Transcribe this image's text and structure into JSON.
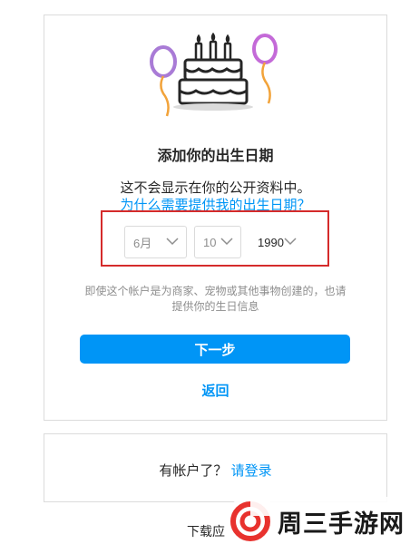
{
  "dialog": {
    "title": "添加你的出生日期",
    "subtitle": "这不会显示在你的公开资料中。",
    "why_link": "为什么需要提供我的出生日期？",
    "month": "6月",
    "day": "10",
    "year": "1990",
    "note_line1": "即使这个帐户是为商家、宠物或其他事物创建的，也请",
    "note_line2": "提供你的生日信息",
    "next_button": "下一步",
    "back_link": "返回"
  },
  "login_card": {
    "prompt": "有帐户了？",
    "login_link": "请登录"
  },
  "footer": {
    "download_text": "下载应"
  },
  "watermark": {
    "text": "周三手游网"
  },
  "colors": {
    "accent": "#0095f6",
    "highlight_box": "#d52b2b",
    "balloon_left": "#a97bd6",
    "balloon_right": "#c46ad8",
    "watermark_logo": "#e8322e"
  },
  "icons": [
    "birthday-cake-icon",
    "balloon-icon",
    "chevron-down-icon",
    "watermark-logo-icon"
  ]
}
